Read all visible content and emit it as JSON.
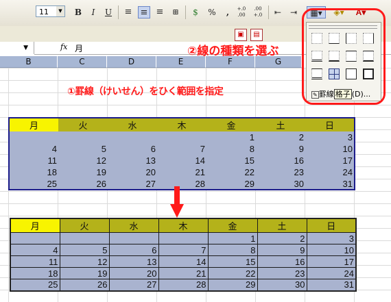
{
  "toolbar": {
    "font_size": "11",
    "bold": "B",
    "italic": "I",
    "underline": "U",
    "percent": "%",
    "comma": ",",
    "dec_inc": "+.0\n.00",
    "dec_dec": ".00\n+.0",
    "font_color_letter": "A"
  },
  "formula": {
    "fx": "fx",
    "value": "月"
  },
  "columns": [
    "B",
    "C",
    "D",
    "E",
    "F",
    "G"
  ],
  "annotations": {
    "step1": "①罫線（けいせん）をひく範囲を指定",
    "step2": "②線の種類を選ぶ"
  },
  "border_menu": {
    "label": "罫線",
    "tooltip": "格子",
    "rest": "(D)..."
  },
  "calendar": {
    "headers": [
      "月",
      "火",
      "水",
      "木",
      "金",
      "土",
      "日"
    ],
    "rows": [
      [
        "",
        "",
        "",
        "",
        "1",
        "2",
        "3"
      ],
      [
        "4",
        "5",
        "6",
        "7",
        "8",
        "9",
        "10"
      ],
      [
        "11",
        "12",
        "13",
        "14",
        "15",
        "16",
        "17"
      ],
      [
        "18",
        "19",
        "20",
        "21",
        "22",
        "23",
        "24"
      ],
      [
        "25",
        "26",
        "27",
        "28",
        "29",
        "30",
        "31"
      ]
    ]
  },
  "colors": {
    "annotation_red": "#ff1a1a",
    "header_yellow": "#f8f400",
    "header_olive": "#b4b21a",
    "cell_blue": "#a9b3cf"
  }
}
